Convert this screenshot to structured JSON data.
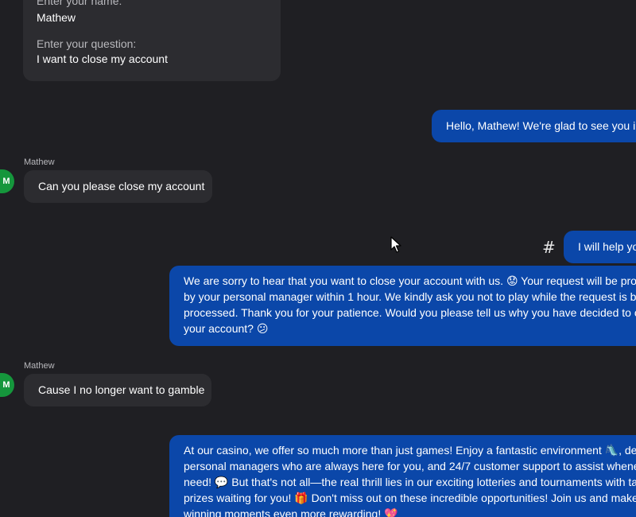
{
  "form": {
    "name_label": "Enter your name:",
    "name_value": "Mathew",
    "question_label": "Enter your question:",
    "question_value": "I want to close my account"
  },
  "messages": {
    "greeting": "Hello, Mathew! We're glad to see you in",
    "user1_sender": "Mathew",
    "user1_text": "Can you please close my account",
    "avatar_initial": "M",
    "help": "I will help yo",
    "hash_icon": "#",
    "sorry_lines": [
      "We are sorry to hear that you want to close your account with us. 😟 Your request will be proce",
      "by your personal manager within 1 hour. We kindly ask you not to play while the request is being",
      "processed. Thank you for your patience. Would you please tell us why you have decided to clos",
      "your account? 😕"
    ],
    "user2_sender": "Mathew",
    "user2_text": "Cause I no longer want to gamble",
    "casino_lines": [
      "At our casino, we offer so much more than just games! Enjoy a fantastic environment 🛝, dedica",
      "personal managers who are always here for you, and 24/7 customer support to assist whenever",
      "need! 💬 But that's not all—the real thrill lies in our exciting lotteries and tournaments with tangi",
      "prizes waiting for you! 🎁 Don't miss out on these incredible opportunities! Join us and make yo",
      "winning moments even more rewarding! 💖"
    ]
  },
  "colors": {
    "background": "#1f1f23",
    "outgoing_bubble": "#0b47a9",
    "incoming_bubble": "#2c2c30",
    "avatar": "#15963c"
  }
}
